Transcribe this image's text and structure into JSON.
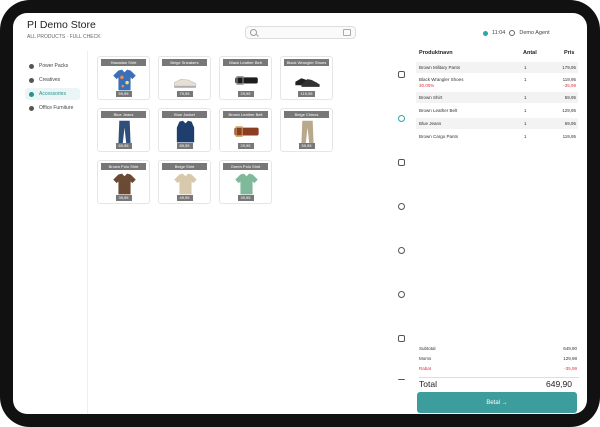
{
  "app": {
    "title": "PI Demo Store",
    "subtitle": "ALL PRODUCTS · FULL CHECK",
    "search_placeholder": "",
    "status_time": "11:04",
    "status_user": "Demo Agent"
  },
  "categories": [
    {
      "label": "Power Packs",
      "active": false
    },
    {
      "label": "Creatives",
      "active": false
    },
    {
      "label": "Accessories",
      "active": true
    },
    {
      "label": "Office Furniture",
      "active": false
    }
  ],
  "products": [
    {
      "name": "Hawaiian Shirt",
      "price": "59,95",
      "icon": "hawaiian-shirt-icon",
      "color": "#3b6fb6"
    },
    {
      "name": "Beige Sneakers",
      "price": "79,95",
      "icon": "sneaker-icon",
      "color": "#e6e0d4"
    },
    {
      "name": "Black Leather Belt",
      "price": "29,95",
      "icon": "belt-icon",
      "color": "#1d1d1d"
    },
    {
      "name": "Black Wrangler Shoes",
      "price": "119,95",
      "icon": "shoe-icon",
      "color": "#222222"
    },
    {
      "name": "Blue Jeans",
      "price": "69,95",
      "icon": "jeans-icon",
      "color": "#2d4f7a"
    },
    {
      "name": "Blue Jacket",
      "price": "89,95",
      "icon": "jacket-icon",
      "color": "#1e3f6e"
    },
    {
      "name": "Brown Leather Belt",
      "price": "29,95",
      "icon": "belt-icon",
      "color": "#8a3e22"
    },
    {
      "name": "Beige Chinos",
      "price": "59,95",
      "icon": "chinos-icon",
      "color": "#b9a98c"
    },
    {
      "name": "Brown Polo Shirt",
      "price": "39,95",
      "icon": "polo-shirt-icon",
      "color": "#6b4a34"
    },
    {
      "name": "Beige Shirt",
      "price": "49,95",
      "icon": "shirt-icon",
      "color": "#d8c9ad"
    },
    {
      "name": "Green Polo Shirt",
      "price": "39,95",
      "icon": "polo-shirt-icon",
      "color": "#7fb89a"
    }
  ],
  "order": {
    "headers": {
      "product": "Produktnavn",
      "qty": "Antal",
      "price": "Pris"
    },
    "rows": [
      {
        "name": "Brown Military Pants",
        "qty": "1",
        "price": "179,95",
        "discount_label": "",
        "discount": ""
      },
      {
        "name": "Black Wrangler Shoes",
        "qty": "1",
        "price": "119,95",
        "discount_label": "30.00%",
        "discount": "-35,99"
      },
      {
        "name": "Brown Shirt",
        "qty": "1",
        "price": "59,95",
        "discount_label": "",
        "discount": ""
      },
      {
        "name": "Brown Leather Belt",
        "qty": "1",
        "price": "129,95",
        "discount_label": "",
        "discount": ""
      },
      {
        "name": "Blue Jeans",
        "qty": "1",
        "price": "69,95",
        "discount_label": "",
        "discount": ""
      },
      {
        "name": "Brown Cargo Pants",
        "qty": "1",
        "price": "119,95",
        "discount_label": "",
        "discount": ""
      }
    ],
    "subtotal_label": "Subtotal",
    "subtotal_value": "649,90",
    "vat_label": "Moms",
    "vat_value": "129,98",
    "discount_label": "Rabat",
    "discount_value": "-35,99",
    "total_label": "Total",
    "total_value": "649,90",
    "pay_label": "Betal →"
  },
  "colors": {
    "accent": "#3d9c9c",
    "discount": "#dd3344"
  }
}
